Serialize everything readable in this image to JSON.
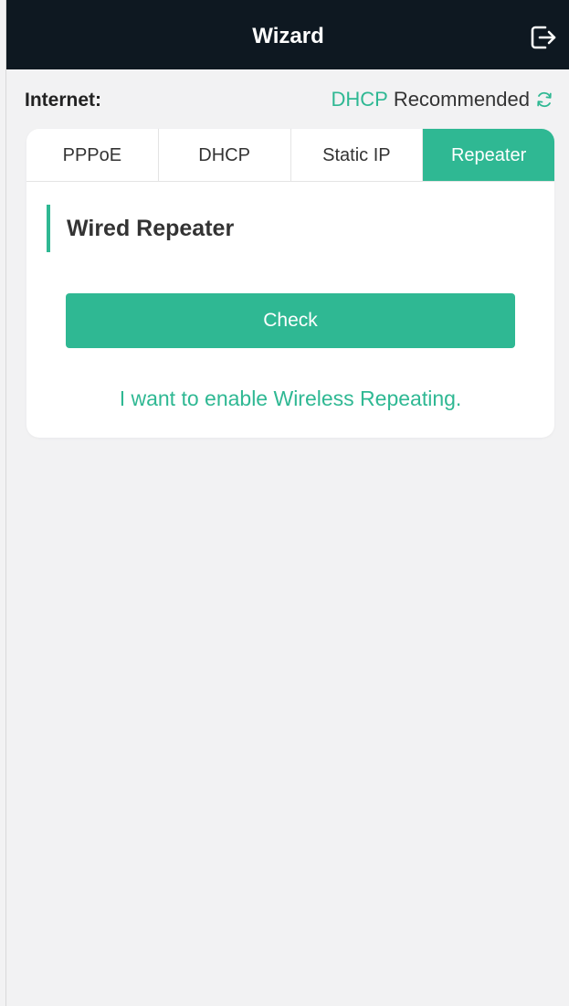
{
  "header": {
    "title": "Wizard",
    "exit_icon": "logout-icon"
  },
  "internet": {
    "label": "Internet:",
    "detected_mode": "DHCP",
    "recommend_text": "Recommended",
    "refresh_icon": "refresh-icon"
  },
  "tabs": [
    {
      "label": "PPPoE",
      "active": false
    },
    {
      "label": "DHCP",
      "active": false
    },
    {
      "label": "Static IP",
      "active": false
    },
    {
      "label": "Repeater",
      "active": true
    }
  ],
  "repeater": {
    "section_title": "Wired Repeater",
    "check_label": "Check",
    "wireless_link": "I want to enable Wireless Repeating."
  },
  "colors": {
    "accent": "#2fb893",
    "header_bg": "#0e1821",
    "page_bg": "#f2f2f3"
  }
}
